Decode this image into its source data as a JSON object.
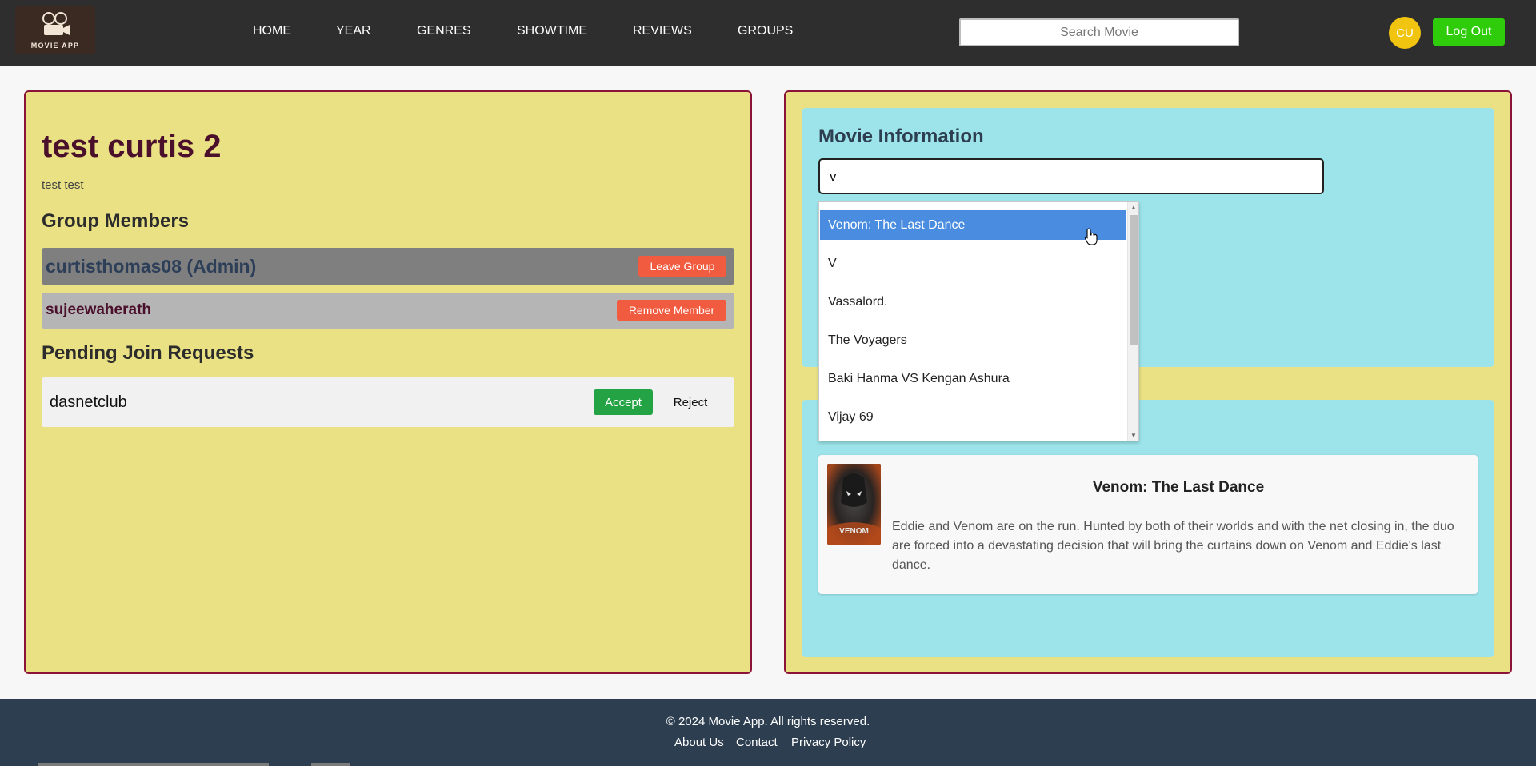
{
  "nav": {
    "logo_text": "MOVIE APP",
    "links": [
      "HOME",
      "YEAR",
      "GENRES",
      "SHOWTIME",
      "REVIEWS",
      "GROUPS"
    ],
    "search_placeholder": "Search Movie",
    "avatar_initials": "CU",
    "logout_label": "Log Out"
  },
  "group": {
    "name": "test curtis 2",
    "description": "test test",
    "members_heading": "Group Members",
    "members": [
      {
        "name": "curtisthomas08 (Admin)",
        "action": "Leave Group"
      },
      {
        "name": "sujeewaherath",
        "action": "Remove Member"
      }
    ],
    "pending_heading": "Pending Join Requests",
    "pending": [
      {
        "name": "dasnetclub",
        "accept": "Accept",
        "reject": "Reject"
      }
    ]
  },
  "movie_info": {
    "heading": "Movie Information",
    "input_value": "v",
    "suggestions": [
      "Venom: The Last Dance",
      "V",
      "Vassalord.",
      "The Voyagers",
      "Baki Hanma VS Kengan Ashura",
      "Vijay 69"
    ],
    "selected_index": 0
  },
  "movie_card": {
    "title": "Venom: The Last Dance",
    "overview": "Eddie and Venom are on the run. Hunted by both of their worlds and with the net closing in, the duo are forced into a devastating decision that will bring the curtains down on Venom and Eddie's last dance.",
    "poster_text": "VENOM"
  },
  "footer": {
    "copyright": "© 2024 Movie App. All rights reserved.",
    "links": [
      "About Us",
      "Contact",
      "Privacy Policy"
    ]
  },
  "colors": {
    "nav_bg": "#2e2e2e",
    "panel_bg": "#e9e183",
    "panel_border": "#8b1538",
    "card_bg": "#9de4ea",
    "accent_red": "#f15b3f",
    "accept_green": "#23a344",
    "logout_green": "#2ecc0a",
    "avatar_yellow": "#f1c40f",
    "footer_bg": "#2c3e50",
    "selected_blue": "#4a8ce0"
  }
}
